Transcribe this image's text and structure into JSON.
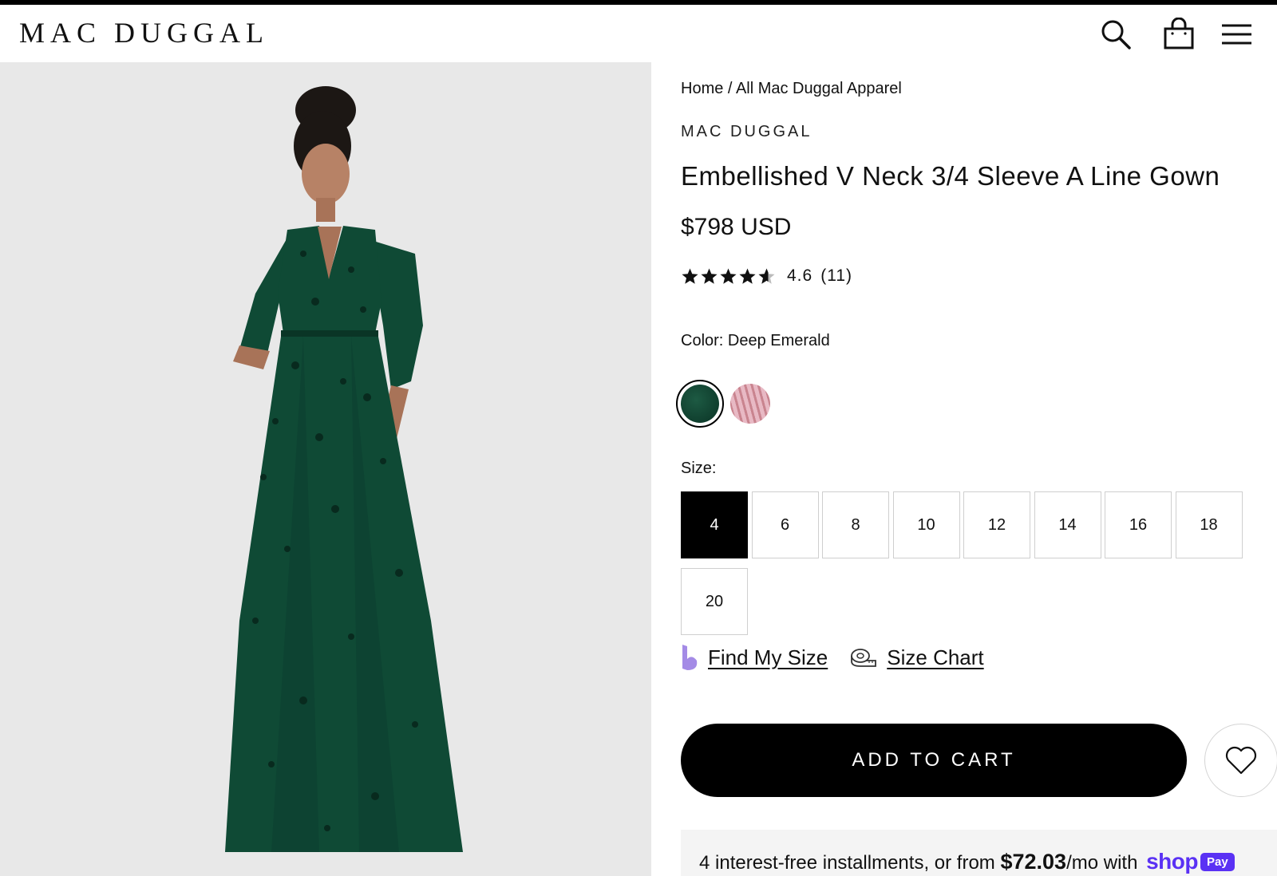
{
  "header": {
    "logo": "MAC DUGGAL",
    "icons": [
      "search-icon",
      "cart-icon",
      "menu-icon"
    ]
  },
  "breadcrumb": {
    "home": "Home",
    "separator": " / ",
    "current": "All Mac Duggal Apparel"
  },
  "product": {
    "brand": "MAC DUGGAL",
    "title": "Embellished V Neck 3/4 Sleeve A Line Gown",
    "price": "$798 USD",
    "rating": {
      "stars": 4.6,
      "label": "4.6",
      "count": "(11)"
    }
  },
  "color": {
    "label": "Color: Deep Emerald",
    "swatches": [
      {
        "name": "Deep Emerald",
        "color": "#0d3b2c",
        "selected": true
      },
      {
        "name": "Blush",
        "color": "#d9a5b2",
        "selected": false
      }
    ]
  },
  "size": {
    "label": "Size:",
    "options": [
      "4",
      "6",
      "8",
      "10",
      "12",
      "14",
      "16",
      "18",
      "20"
    ],
    "selected": "4"
  },
  "helpers": {
    "find_my_size": "Find My Size",
    "size_chart": "Size Chart"
  },
  "actions": {
    "add_to_cart": "ADD TO CART"
  },
  "shop_pay": {
    "prefix": "4 interest-free installments, or from ",
    "amount": "$72.03",
    "suffix": "/mo with ",
    "brand": "shop",
    "badge": "Pay"
  },
  "colors": {
    "gallery_bg": "#e8e8e8",
    "dress": "#0f4a35",
    "shop_pay": "#5a31f4"
  }
}
